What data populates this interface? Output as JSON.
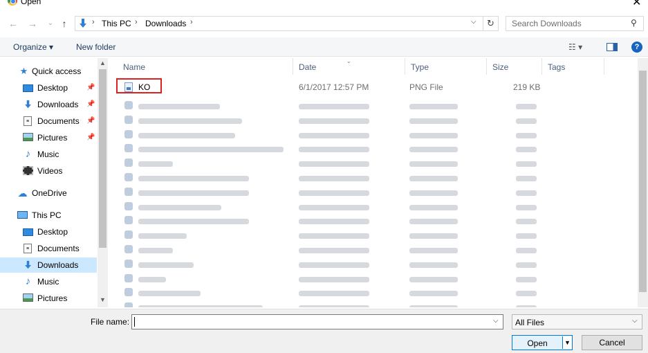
{
  "window": {
    "title": "Open",
    "close_glyph": "✕"
  },
  "address": {
    "segments": [
      "This PC",
      "Downloads"
    ],
    "search_placeholder": "Search Downloads"
  },
  "toolbar": {
    "organize": "Organize ▾",
    "new_folder": "New folder"
  },
  "nav": {
    "items": [
      {
        "label": "Quick access",
        "icon": "star-icon",
        "pinned": false
      },
      {
        "label": "Desktop",
        "icon": "desktop-icon",
        "pinned": true
      },
      {
        "label": "Downloads",
        "icon": "download-arrow-icon",
        "pinned": true
      },
      {
        "label": "Documents",
        "icon": "document-icon",
        "pinned": true
      },
      {
        "label": "Pictures",
        "icon": "picture-icon",
        "pinned": true
      },
      {
        "label": "Music",
        "icon": "music-note-icon",
        "pinned": false
      },
      {
        "label": "Videos",
        "icon": "film-icon",
        "pinned": false
      },
      {
        "label": "OneDrive",
        "icon": "cloud-icon",
        "pinned": false
      },
      {
        "label": "This PC",
        "icon": "computer-icon",
        "pinned": false
      },
      {
        "label": "Desktop",
        "icon": "desktop-icon",
        "pinned": false
      },
      {
        "label": "Documents",
        "icon": "document-icon",
        "pinned": false
      },
      {
        "label": "Downloads",
        "icon": "download-arrow-icon",
        "pinned": false,
        "selected": true
      },
      {
        "label": "Music",
        "icon": "music-note-icon",
        "pinned": false
      },
      {
        "label": "Pictures",
        "icon": "picture-icon",
        "pinned": false
      }
    ]
  },
  "columns": {
    "name": "Name",
    "date": "Date",
    "type": "Type",
    "size": "Size",
    "tags": "Tags"
  },
  "files": [
    {
      "name": "KO",
      "date": "6/1/2017 12:57 PM",
      "type": "PNG File",
      "size": "219 KB"
    }
  ],
  "bottom": {
    "file_name_label": "File name:",
    "file_name_value": "",
    "filter_value": "All Files",
    "open_label": "Open",
    "cancel_label": "Cancel"
  },
  "colors": {
    "accent": "#0078d7",
    "selected": "#cce8ff",
    "highlight": "#e02020"
  }
}
